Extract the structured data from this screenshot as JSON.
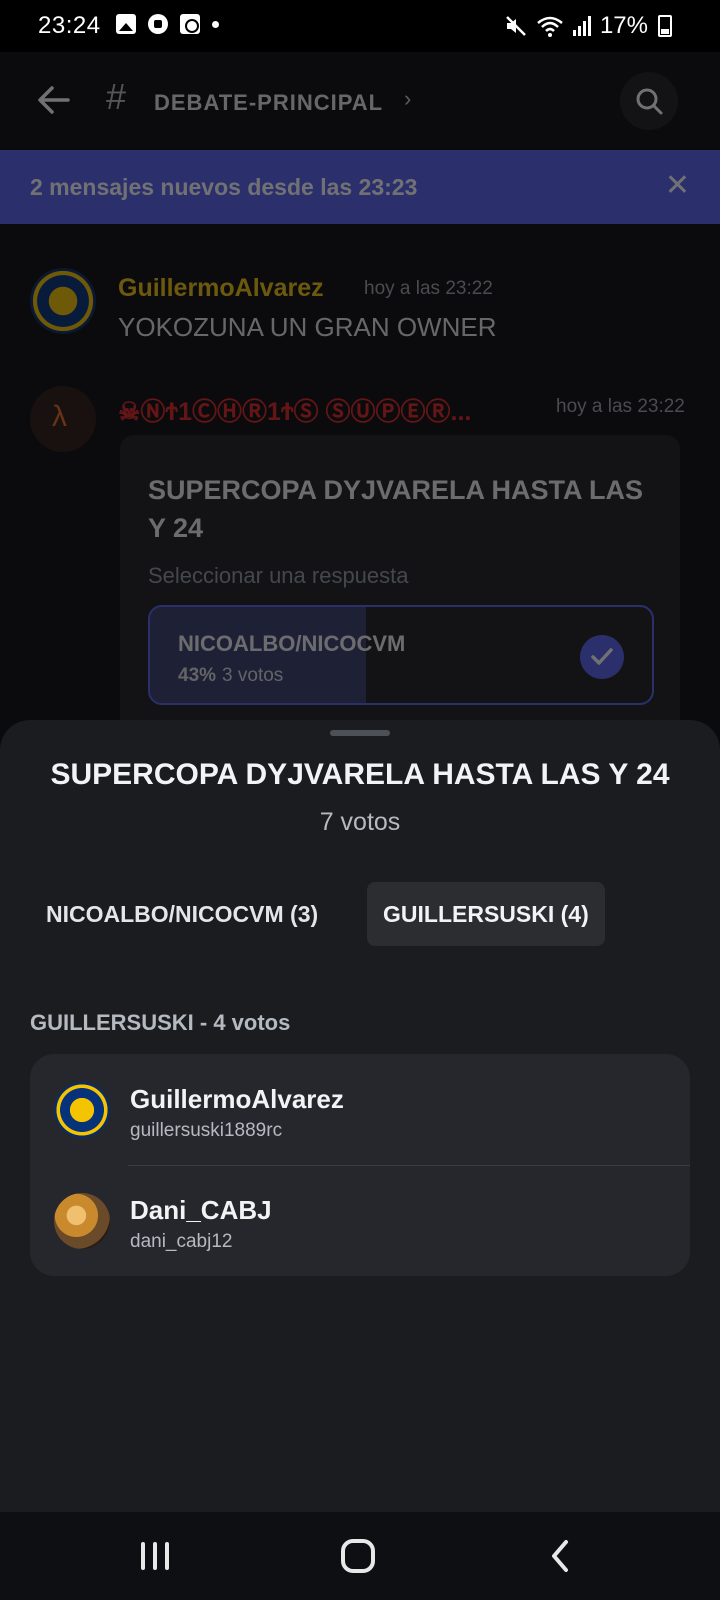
{
  "status_bar": {
    "time": "23:24",
    "battery": "17%",
    "icons": [
      "gallery-icon",
      "soccer-ball-icon",
      "clock-app-icon",
      "notification-dot",
      "mute-icon",
      "wifi-icon",
      "signal-icon",
      "battery-charging-icon"
    ]
  },
  "header": {
    "channel_name": "DEBATE-PRINCIPAL",
    "hash_symbol": "#",
    "chevron": "›"
  },
  "banner": {
    "text": "2 mensajes nuevos desde las 23:23",
    "close": "✕"
  },
  "messages": [
    {
      "author": "GuillermoAlvarez",
      "author_color": "#f1c40f",
      "time": "hoy a las 23:22",
      "text": "YOKOZUNA UN GRAN OWNER"
    },
    {
      "author": "☠ⓃϮ1ⒸⒽⓇ1ϮⓈ ⓈⓊⓅⒺⓇ...",
      "author_color": "#e02424",
      "time": "hoy a las 23:22"
    }
  ],
  "poll_card": {
    "question": "SUPERCOPA DYJVARELA HASTA LAS Y 24",
    "instruction": "Seleccionar una respuesta",
    "option": {
      "label": "NICOALBO/NICOCVM",
      "percent": "43%",
      "votes": "3 votos",
      "fill_fraction": 0.43
    }
  },
  "sheet": {
    "title": "SUPERCOPA DYJVARELA HASTA LAS Y 24",
    "total_votes": "7 votos",
    "tabs": [
      {
        "label": "NICOALBO/NICOCVM (3)",
        "active": false
      },
      {
        "label": "GUILLERSUSKI (4)",
        "active": true
      }
    ],
    "section_label": "GUILLERSUSKI - 4 votos",
    "voters": [
      {
        "name": "GuillermoAlvarez",
        "username": "guillersuski1889rc"
      },
      {
        "name": "Dani_CABJ",
        "username": "dani_cabj12"
      }
    ]
  },
  "colors": {
    "accent": "#5865f2",
    "sheet_bg": "#1b1c20",
    "card_bg": "#26272d"
  }
}
